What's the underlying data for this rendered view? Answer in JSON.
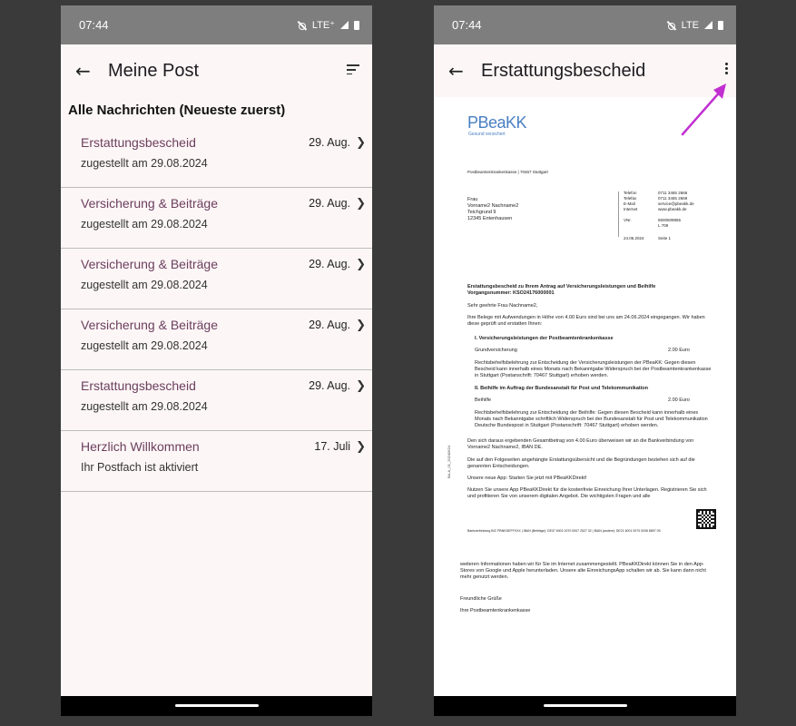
{
  "colors": {
    "accent": "#6b3f5e",
    "arrow": "#c12fd1",
    "statusbar": "#7e7e7e"
  },
  "left": {
    "status": {
      "time": "07:44",
      "network": "LTE⁺"
    },
    "appbar": {
      "back_icon": "back-arrow-icon",
      "title": "Meine Post",
      "sort_icon": "sort-icon"
    },
    "section_title": "Alle Nachrichten (Neueste zuerst)",
    "items": [
      {
        "title": "Erstattungsbescheid",
        "subtitle": "zugestellt am 29.08.2024",
        "date": "29. Aug."
      },
      {
        "title": "Versicherung & Beiträge",
        "subtitle": "zugestellt am 29.08.2024",
        "date": "29. Aug."
      },
      {
        "title": "Versicherung & Beiträge",
        "subtitle": "zugestellt am 29.08.2024",
        "date": "29. Aug."
      },
      {
        "title": "Versicherung & Beiträge",
        "subtitle": "zugestellt am 29.08.2024",
        "date": "29. Aug."
      },
      {
        "title": "Erstattungsbescheid",
        "subtitle": "zugestellt am 29.08.2024",
        "date": "29. Aug."
      },
      {
        "title": "Herzlich Willkommen",
        "subtitle": "Ihr Postfach ist aktiviert",
        "date": "17. Juli"
      }
    ]
  },
  "right": {
    "status": {
      "time": "07:44",
      "network": "LTE"
    },
    "appbar": {
      "back_icon": "back-arrow-icon",
      "title": "Erstattungsbescheid",
      "menu_icon": "more-vert-icon"
    },
    "doc": {
      "logo": "PBeaKK",
      "logo_tag": "Gesund versichert",
      "sender_line": "Postbeamtenkrankenkasse | 70467 Stuttgart",
      "address": [
        "Frau",
        "Vorname2 Nachname2",
        "Teichgrund 9",
        "12345 Entenhausen"
      ],
      "contact_labels": [
        "Telefon",
        "Telefax",
        "E-Mail",
        "Internet",
        "",
        "VNr.",
        "",
        "24.06.2024"
      ],
      "contact_values": [
        "0711 3465 2666",
        "0711 3465 2669",
        "service@pbeakk.de",
        "www.pbeakk.de",
        "",
        "5500509855",
        "L 709",
        "Seite 1"
      ],
      "subject": "Erstattungsbescheid zu Ihrem Antrag auf Versicherungsleistungen und Beihilfe",
      "case_number": "Vorgangsnummer: KSO24176000001",
      "greeting": "Sehr geehrte Frau Nachname2,",
      "intro": "Ihre Belege mit Aufwendungen in Höhe von 4.00 Euro sind bei uns am 24.06.2024 eingegangen. Wir haben diese geprüft und erstatten Ihnen:",
      "section1": "I.  Versicherungsleistungen der Postbeamtenkrankenkasse",
      "section1_item": "Grundversicherung",
      "section1_amount": "2.00 Euro",
      "section1_text": "Rechtsbehelfsbelehrung zur Entscheidung der Versicherungsleistungen der PBeaKK: Gegen diesen Bescheid kann innerhalb eines Monats nach Bekanntgabe Widerspruch bei der Postbeamtenkrankenkasse in Stuttgart (Postanschrift: 70467 Stuttgart) erhoben werden.",
      "section2": "II.  Beihilfe im Auftrag der Bundesanstalt für Post und Telekommunikation",
      "section2_item": "Beihilfe",
      "section2_amount": "2.00 Euro",
      "section2_text": "Rechtsbehelfsbelehrung zur Entscheidung der Beihilfe: Gegen diesen Bescheid kann innerhalb eines Monats nach Bekanntgabe schriftlich Widerspruch bei der Bundesanstalt für Post und Telekommunikation Deutsche Bundespost in Stuttgart (Postanschrift: 70467 Stuttgart) erhoben werden.",
      "total": "Den sich daraus ergebenden Gesamtbetrag von 4.00 Euro überweisen wir an die Bankverbindung von Vorname2 Nachname2, IBAN DE.",
      "attachments": "Die auf den Folgeseiten angehängte Erstattungsübersicht und die Begründungen beziehen sich auf die genannten Entscheidungen.",
      "app_head": "Unsere neue App:  Starten Sie jetzt mit PBeaKKDirekt!",
      "app_text": "Nutzen Sie unsere App PBeaKKDirekt für die kostenfreie Einreichung Ihrer Unterlagen. Registrieren Sie sich und profitieren Sie von unserem digitalen Angebot. Die wichtigsten Fragen und alle",
      "footer": "Bankverbindung BIC PBNKDEFFXXX | IBAN (Beiträge): DE37 6001 0070 0007 2527 02 | IBAN (andere): DE21 6001 0070 0036 8897 05",
      "side_code": "BA-A_01_20240624",
      "more_text": "weiteren Informationen haben wir für Sie im Internet zusammengestellt. PBeaKKDirekt können Sie in den App-Stores von Google und Apple herunterladen. Unsere alte EinreichungsApp schalten wir ab. Sie kann dann nicht mehr genutzt werden.",
      "closing": "Freundliche Grüße",
      "signature": "Ihre Postbeamtenkrankenkasse"
    }
  }
}
